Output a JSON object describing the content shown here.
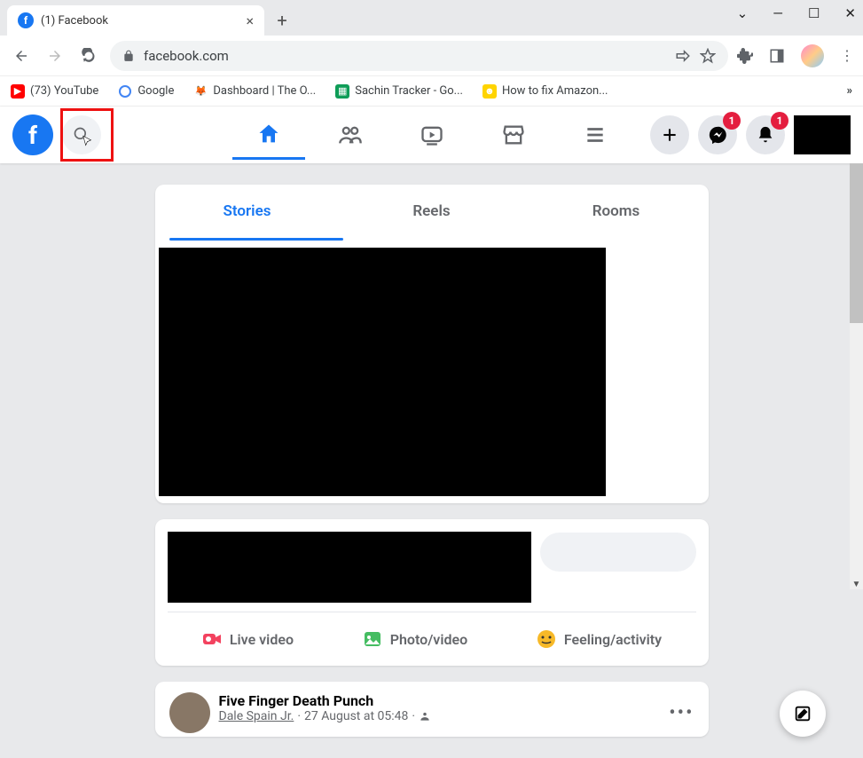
{
  "browser": {
    "tab_title": "(1) Facebook",
    "url": "facebook.com",
    "bookmarks": [
      {
        "label": "(73) YouTube"
      },
      {
        "label": "Google"
      },
      {
        "label": "Dashboard | The O..."
      },
      {
        "label": "Sachin Tracker - Go..."
      },
      {
        "label": "How to fix Amazon..."
      }
    ]
  },
  "fb_header": {
    "messenger_badge": "1",
    "notifications_badge": "1"
  },
  "stories": {
    "tabs": [
      "Stories",
      "Reels",
      "Rooms"
    ]
  },
  "composer": {
    "actions": [
      "Live video",
      "Photo/video",
      "Feeling/activity"
    ]
  },
  "post": {
    "title": "Five Finger Death Punch",
    "author": "Dale Spain Jr.",
    "time": "27 August at 05:48"
  }
}
